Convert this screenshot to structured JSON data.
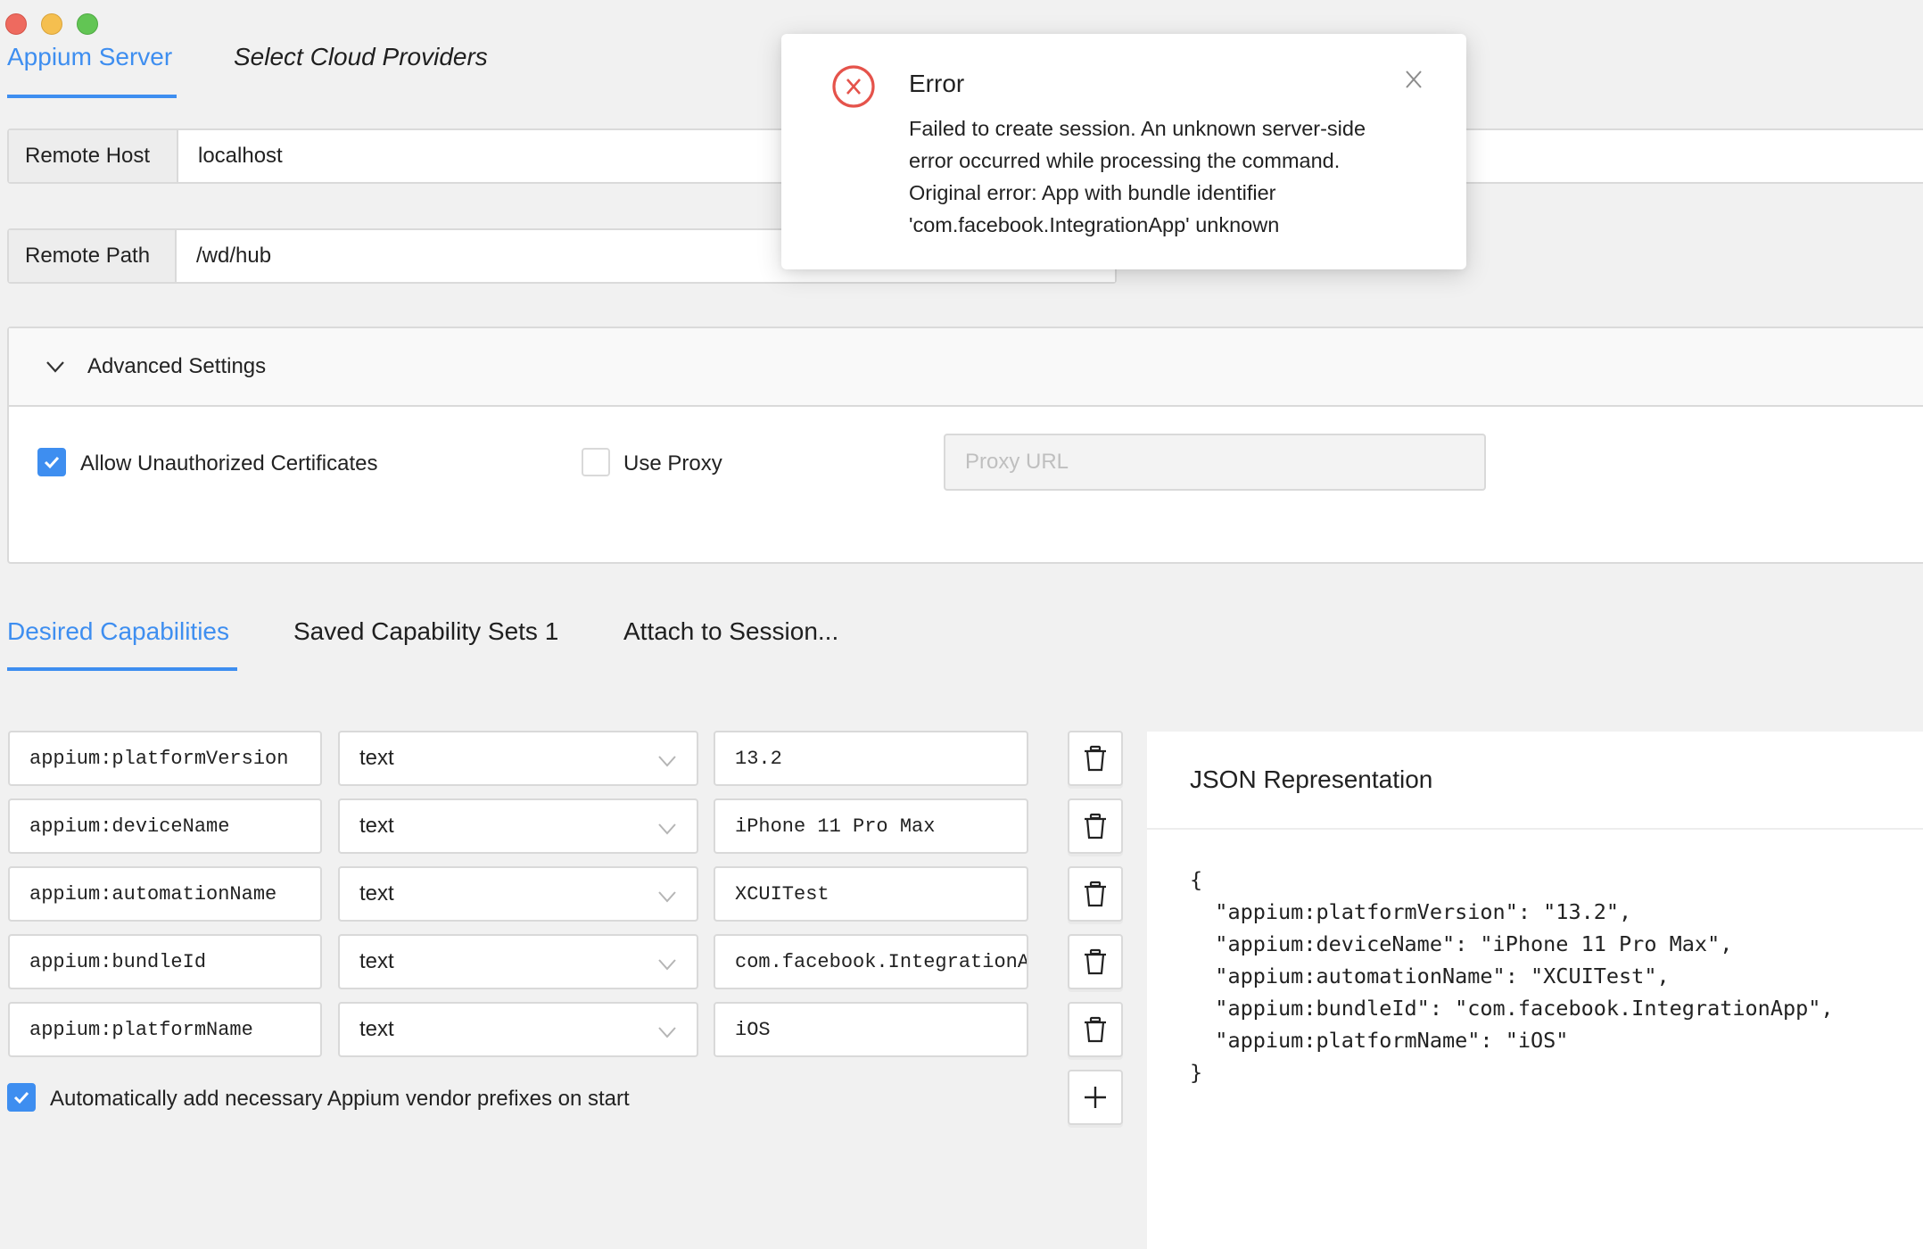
{
  "window": {
    "controls": [
      "close",
      "minimize",
      "zoom"
    ]
  },
  "top_tabs": [
    {
      "label": "Appium Server",
      "active": true
    },
    {
      "label": "Select Cloud Providers",
      "active": false
    }
  ],
  "server": {
    "remote_host_label": "Remote Host",
    "remote_host_value": "localhost",
    "remote_path_label": "Remote Path",
    "remote_path_value": "/wd/hub"
  },
  "advanced": {
    "title": "Advanced Settings",
    "expanded": true,
    "allow_unauthorized_label": "Allow Unauthorized Certificates",
    "allow_unauthorized_checked": true,
    "use_proxy_label": "Use Proxy",
    "use_proxy_checked": false,
    "proxy_url_placeholder": "Proxy URL",
    "proxy_url_value": ""
  },
  "capability_tabs": [
    {
      "label": "Desired Capabilities",
      "active": true
    },
    {
      "label": "Saved Capability Sets 1",
      "active": false
    },
    {
      "label": "Attach to Session...",
      "active": false
    }
  ],
  "capabilities": [
    {
      "name": "appium:platformVersion",
      "type": "text",
      "value": "13.2"
    },
    {
      "name": "appium:deviceName",
      "type": "text",
      "value": "iPhone 11 Pro Max"
    },
    {
      "name": "appium:automationName",
      "type": "text",
      "value": "XCUITest"
    },
    {
      "name": "appium:bundleId",
      "type": "text",
      "value": "com.facebook.IntegrationApp"
    },
    {
      "name": "appium:platformName",
      "type": "text",
      "value": "iOS"
    }
  ],
  "auto_prefix": {
    "label": "Automatically add necessary Appium vendor prefixes on start",
    "checked": true
  },
  "json_panel": {
    "title": "JSON Representation",
    "lines": [
      "{",
      "  \"appium:platformVersion\": \"13.2\",",
      "  \"appium:deviceName\": \"iPhone 11 Pro Max\",",
      "  \"appium:automationName\": \"XCUITest\",",
      "  \"appium:bundleId\": \"com.facebook.IntegrationApp\",",
      "  \"appium:platformName\": \"iOS\"",
      "}"
    ]
  },
  "error_dialog": {
    "title": "Error",
    "message_lines": [
      "Failed to create session. An unknown server-side",
      "error occurred while processing the command.",
      "Original error: App with bundle identifier",
      "'com.facebook.IntegrationApp' unknown"
    ],
    "icon": "error-circle-x-icon",
    "close_icon": "close-icon"
  },
  "colors": {
    "accent": "#3e8ef0",
    "error": "#e5534b",
    "background": "#f1f1f1"
  }
}
